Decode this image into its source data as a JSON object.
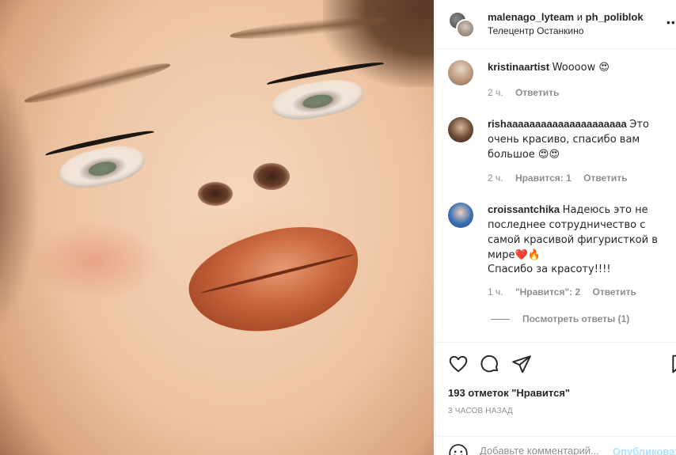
{
  "post": {
    "authors": {
      "first": "malenago_lyteam",
      "joiner": "и",
      "second": "ph_poliblok"
    },
    "location": "Телецентр Останкино",
    "more_icon": "more-horizontal-icon"
  },
  "comments": [
    {
      "username": "kristinaartist",
      "text": "Woooow 😍",
      "time": "2 ч.",
      "reply": "Ответить"
    },
    {
      "username": "rishaаааааааааааааааааааа",
      "text": "Это очень красиво, спасибо вам большое 😍😍",
      "time": "2 ч.",
      "likes": "Нравится: 1",
      "reply": "Ответить"
    },
    {
      "username": "croissantchika",
      "text": "Надеюсь это не последнее сотрудничество с самой красивой фигуристкой в мире❤️🔥",
      "text2": "Спасибо за красоту!!!!",
      "time": "1 ч.",
      "likes": "\"Нравится\": 2",
      "reply": "Ответить"
    }
  ],
  "view_replies": "Посмотреть ответы (1)",
  "likes_count": "193 отметок \"Нравится\"",
  "time_ago": "3 ЧАСОВ НАЗАД",
  "add_comment": {
    "placeholder": "Добавьте комментарий...",
    "publish": "Опубликовать"
  },
  "colors": {
    "accent": "#0095f6",
    "publish_disabled": "#b2dffc",
    "muted": "#8e8e8e"
  }
}
